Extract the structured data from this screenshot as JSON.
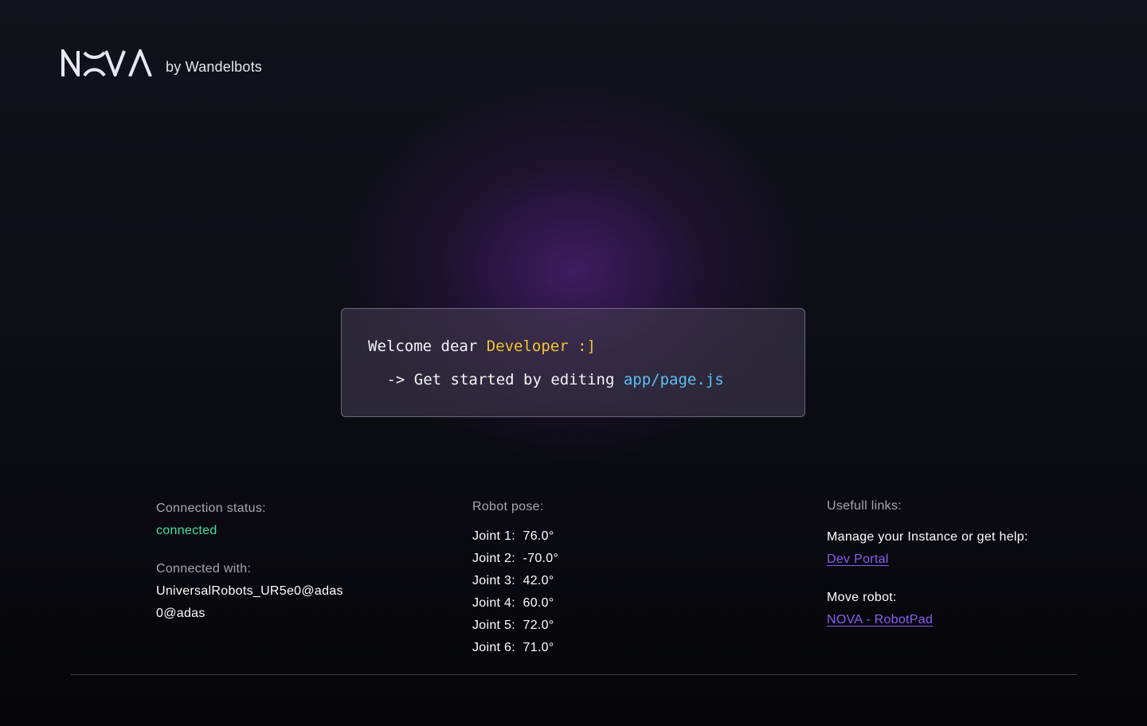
{
  "header": {
    "logo_text": "NOVA",
    "by_label": "by Wandelbots"
  },
  "welcome": {
    "prefix": "Welcome dear ",
    "highlight": "Developer :]",
    "line2_prefix": " -> Get started by editing ",
    "file": "app/page.js"
  },
  "connection": {
    "status_label": "Connection status:",
    "status_value": "connected",
    "with_label": "Connected with:",
    "with_line1": "UniversalRobots_UR5e0@adas",
    "with_line2": "0@adas"
  },
  "pose": {
    "label": "Robot pose:",
    "joints": [
      {
        "name": "Joint 1:",
        "value": "76.0°"
      },
      {
        "name": "Joint 2:",
        "value": "-70.0°"
      },
      {
        "name": "Joint 3:",
        "value": "42.0°"
      },
      {
        "name": "Joint 4:",
        "value": "60.0°"
      },
      {
        "name": "Joint 5:",
        "value": "72.0°"
      },
      {
        "name": "Joint 6:",
        "value": "71.0°"
      }
    ]
  },
  "links": {
    "label": "Usefull links:",
    "manage_text": "Manage your Instance or get help:",
    "dev_portal": "Dev Portal ",
    "move_text": "Move robot:",
    "robotpad": "NOVA - RobotPad"
  },
  "colors": {
    "status_connected": "#3fe0a3",
    "link": "#8a5cf6",
    "highlight_yellow": "#f4c430",
    "file_blue": "#5cc1f2",
    "glow_purple": "#7328aa"
  }
}
